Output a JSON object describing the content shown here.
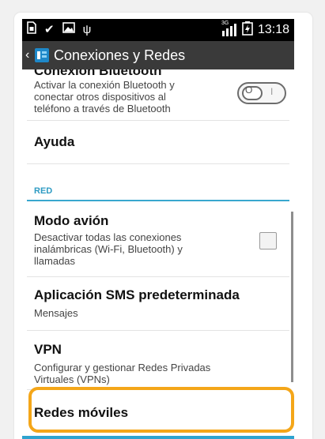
{
  "status_bar": {
    "icons_left": [
      "sim-card-icon",
      "check-icon",
      "image-icon",
      "usb-icon"
    ],
    "network": "3G",
    "time": "13:18"
  },
  "action_bar": {
    "title": "Conexiones y Redes"
  },
  "settings": {
    "bluetooth": {
      "title": "Conexión Bluetooth",
      "summary_line1": "Activar la conexión Bluetooth y",
      "summary_line2": "conectar otros dispositivos al",
      "summary_line3": "teléfono a través de Bluetooth",
      "toggle_off": "O",
      "toggle_on": "I"
    },
    "help": {
      "title": "Ayuda"
    },
    "network_section": {
      "label": "RED"
    },
    "airplane": {
      "title": "Modo avión",
      "summary_line1": "Desactivar todas las conexiones",
      "summary_line2": "inalámbricas (Wi-Fi, Bluetooth) y",
      "summary_line3": "llamadas"
    },
    "sms_default": {
      "title": "Aplicación SMS predeterminada",
      "summary": "Mensajes"
    },
    "vpn": {
      "title": "VPN",
      "summary_line1": "Configurar y gestionar Redes Privadas",
      "summary_line2": "Virtuales (VPNs)"
    },
    "mobile_networks": {
      "title": "Redes móviles"
    }
  },
  "colors": {
    "section_accent": "#2e9bc3",
    "highlight": "#f4a619",
    "status_bar_bg": "#000000",
    "action_bar_bg": "#3a3a3a"
  }
}
